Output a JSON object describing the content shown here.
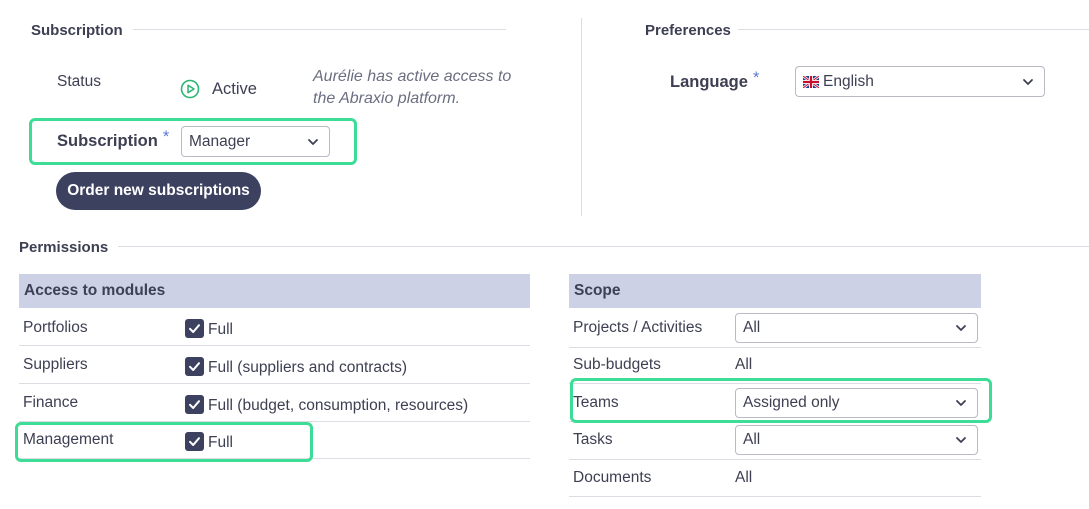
{
  "subscription_section": {
    "title": "Subscription",
    "status_label": "Status",
    "status_value": "Active",
    "status_note": "Aurélie has active access to the Abraxio platform.",
    "subscription_label": "Subscription",
    "required_mark": "*",
    "subscription_value": "Manager",
    "order_button": "Order new subscriptions"
  },
  "preferences_section": {
    "title": "Preferences",
    "language_label": "Language",
    "required_mark": "*",
    "language_value": "English"
  },
  "permissions_section": {
    "title": "Permissions",
    "modules": {
      "header": "Access to modules",
      "rows": [
        {
          "name": "Portfolios",
          "value": "Full"
        },
        {
          "name": "Suppliers",
          "value": "Full (suppliers and contracts)"
        },
        {
          "name": "Finance",
          "value": "Full (budget, consumption, resources)"
        },
        {
          "name": "Management",
          "value": "Full"
        }
      ]
    },
    "scope": {
      "header": "Scope",
      "rows": [
        {
          "name": "Projects / Activities",
          "value": "All"
        },
        {
          "name": "Sub-budgets",
          "value": "All"
        },
        {
          "name": "Teams",
          "value": "Assigned only"
        },
        {
          "name": "Tasks",
          "value": "All"
        },
        {
          "name": "Documents",
          "value": "All"
        }
      ]
    }
  },
  "colors": {
    "accent_dark": "#3d4160",
    "table_header": "#cdd1e6",
    "highlight": "#3ddc97",
    "status_green": "#2bb673"
  },
  "icons": {
    "status": "play-circle-icon",
    "dropdown": "chevron-down-icon",
    "checkbox": "check-icon",
    "flag": "uk-flag-icon"
  }
}
